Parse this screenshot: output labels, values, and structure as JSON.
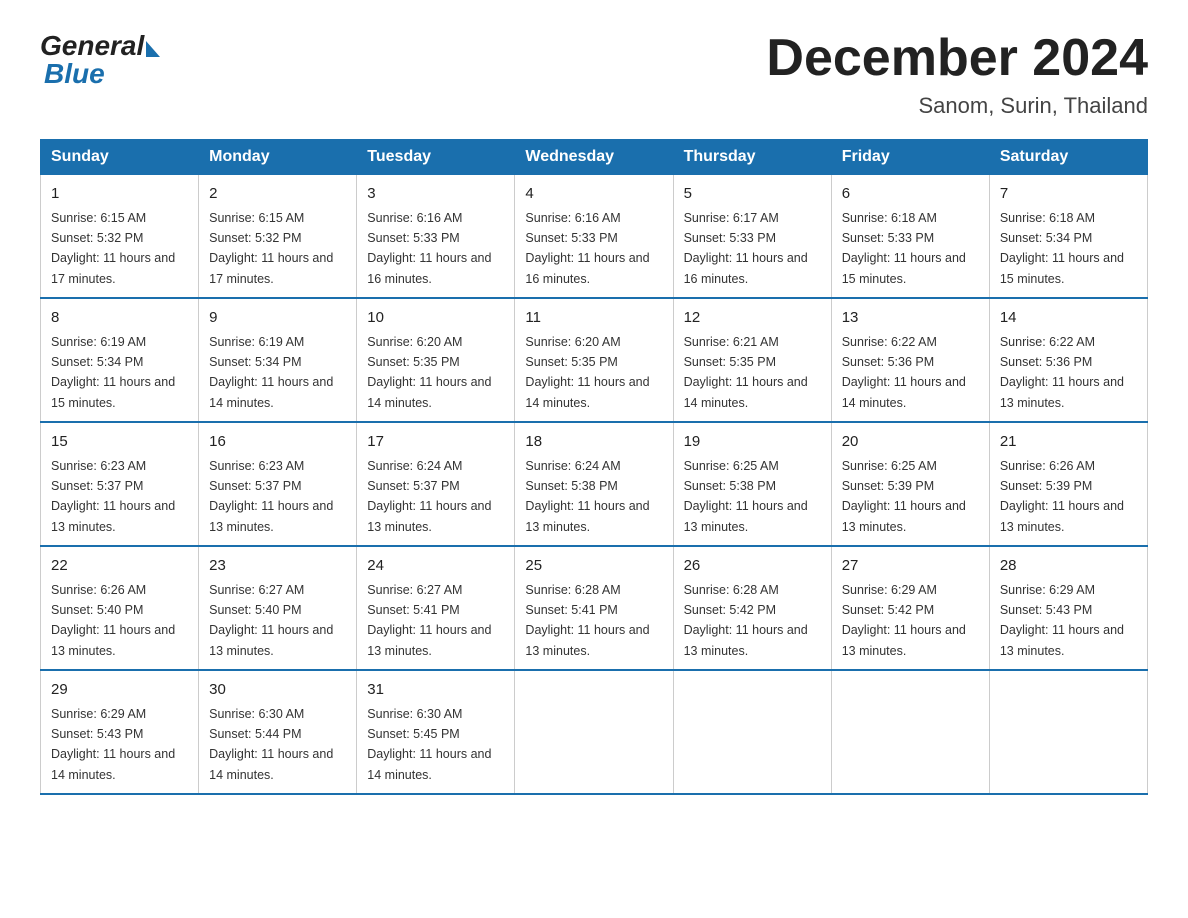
{
  "logo": {
    "general": "General",
    "blue": "Blue"
  },
  "title": "December 2024",
  "subtitle": "Sanom, Surin, Thailand",
  "days_of_week": [
    "Sunday",
    "Monday",
    "Tuesday",
    "Wednesday",
    "Thursday",
    "Friday",
    "Saturday"
  ],
  "weeks": [
    [
      {
        "day": "1",
        "sunrise": "6:15 AM",
        "sunset": "5:32 PM",
        "daylight": "11 hours and 17 minutes."
      },
      {
        "day": "2",
        "sunrise": "6:15 AM",
        "sunset": "5:32 PM",
        "daylight": "11 hours and 17 minutes."
      },
      {
        "day": "3",
        "sunrise": "6:16 AM",
        "sunset": "5:33 PM",
        "daylight": "11 hours and 16 minutes."
      },
      {
        "day": "4",
        "sunrise": "6:16 AM",
        "sunset": "5:33 PM",
        "daylight": "11 hours and 16 minutes."
      },
      {
        "day": "5",
        "sunrise": "6:17 AM",
        "sunset": "5:33 PM",
        "daylight": "11 hours and 16 minutes."
      },
      {
        "day": "6",
        "sunrise": "6:18 AM",
        "sunset": "5:33 PM",
        "daylight": "11 hours and 15 minutes."
      },
      {
        "day": "7",
        "sunrise": "6:18 AM",
        "sunset": "5:34 PM",
        "daylight": "11 hours and 15 minutes."
      }
    ],
    [
      {
        "day": "8",
        "sunrise": "6:19 AM",
        "sunset": "5:34 PM",
        "daylight": "11 hours and 15 minutes."
      },
      {
        "day": "9",
        "sunrise": "6:19 AM",
        "sunset": "5:34 PM",
        "daylight": "11 hours and 14 minutes."
      },
      {
        "day": "10",
        "sunrise": "6:20 AM",
        "sunset": "5:35 PM",
        "daylight": "11 hours and 14 minutes."
      },
      {
        "day": "11",
        "sunrise": "6:20 AM",
        "sunset": "5:35 PM",
        "daylight": "11 hours and 14 minutes."
      },
      {
        "day": "12",
        "sunrise": "6:21 AM",
        "sunset": "5:35 PM",
        "daylight": "11 hours and 14 minutes."
      },
      {
        "day": "13",
        "sunrise": "6:22 AM",
        "sunset": "5:36 PM",
        "daylight": "11 hours and 14 minutes."
      },
      {
        "day": "14",
        "sunrise": "6:22 AM",
        "sunset": "5:36 PM",
        "daylight": "11 hours and 13 minutes."
      }
    ],
    [
      {
        "day": "15",
        "sunrise": "6:23 AM",
        "sunset": "5:37 PM",
        "daylight": "11 hours and 13 minutes."
      },
      {
        "day": "16",
        "sunrise": "6:23 AM",
        "sunset": "5:37 PM",
        "daylight": "11 hours and 13 minutes."
      },
      {
        "day": "17",
        "sunrise": "6:24 AM",
        "sunset": "5:37 PM",
        "daylight": "11 hours and 13 minutes."
      },
      {
        "day": "18",
        "sunrise": "6:24 AM",
        "sunset": "5:38 PM",
        "daylight": "11 hours and 13 minutes."
      },
      {
        "day": "19",
        "sunrise": "6:25 AM",
        "sunset": "5:38 PM",
        "daylight": "11 hours and 13 minutes."
      },
      {
        "day": "20",
        "sunrise": "6:25 AM",
        "sunset": "5:39 PM",
        "daylight": "11 hours and 13 minutes."
      },
      {
        "day": "21",
        "sunrise": "6:26 AM",
        "sunset": "5:39 PM",
        "daylight": "11 hours and 13 minutes."
      }
    ],
    [
      {
        "day": "22",
        "sunrise": "6:26 AM",
        "sunset": "5:40 PM",
        "daylight": "11 hours and 13 minutes."
      },
      {
        "day": "23",
        "sunrise": "6:27 AM",
        "sunset": "5:40 PM",
        "daylight": "11 hours and 13 minutes."
      },
      {
        "day": "24",
        "sunrise": "6:27 AM",
        "sunset": "5:41 PM",
        "daylight": "11 hours and 13 minutes."
      },
      {
        "day": "25",
        "sunrise": "6:28 AM",
        "sunset": "5:41 PM",
        "daylight": "11 hours and 13 minutes."
      },
      {
        "day": "26",
        "sunrise": "6:28 AM",
        "sunset": "5:42 PM",
        "daylight": "11 hours and 13 minutes."
      },
      {
        "day": "27",
        "sunrise": "6:29 AM",
        "sunset": "5:42 PM",
        "daylight": "11 hours and 13 minutes."
      },
      {
        "day": "28",
        "sunrise": "6:29 AM",
        "sunset": "5:43 PM",
        "daylight": "11 hours and 13 minutes."
      }
    ],
    [
      {
        "day": "29",
        "sunrise": "6:29 AM",
        "sunset": "5:43 PM",
        "daylight": "11 hours and 14 minutes."
      },
      {
        "day": "30",
        "sunrise": "6:30 AM",
        "sunset": "5:44 PM",
        "daylight": "11 hours and 14 minutes."
      },
      {
        "day": "31",
        "sunrise": "6:30 AM",
        "sunset": "5:45 PM",
        "daylight": "11 hours and 14 minutes."
      },
      null,
      null,
      null,
      null
    ]
  ]
}
